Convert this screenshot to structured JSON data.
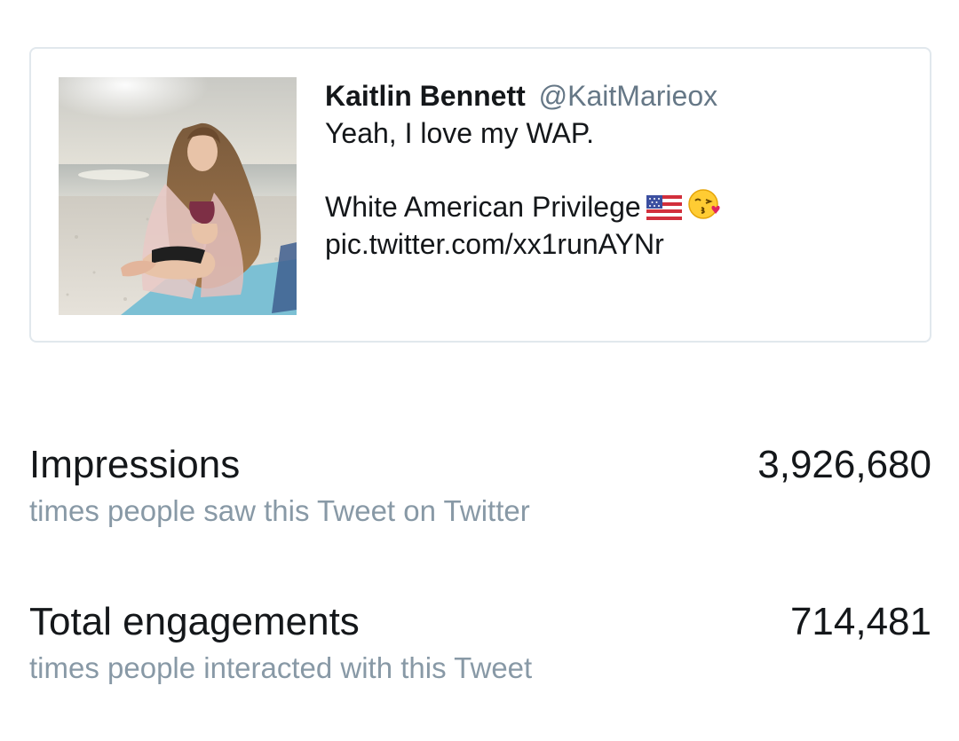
{
  "tweet": {
    "author_name": "Kaitlin Bennett",
    "author_handle": "@KaitMarieox",
    "text_line1": "Yeah, I love my WAP.",
    "text_line2": "White American Privilege",
    "text_line2_icons": [
      "us-flag-icon",
      "kissing-face-icon"
    ],
    "link": "pic.twitter.com/xx1runAYNr",
    "photo": "woman-on-beach-photo"
  },
  "metrics": [
    {
      "title": "Impressions",
      "description": "times people saw this Tweet on Twitter",
      "value": "3,926,680"
    },
    {
      "title": "Total engagements",
      "description": "times people interacted with this Tweet",
      "value": "714,481"
    }
  ],
  "colors": {
    "primary_text": "#14171a",
    "handle_text": "#657786",
    "secondary_text": "#8899a6",
    "card_border": "#e1e8ed"
  }
}
